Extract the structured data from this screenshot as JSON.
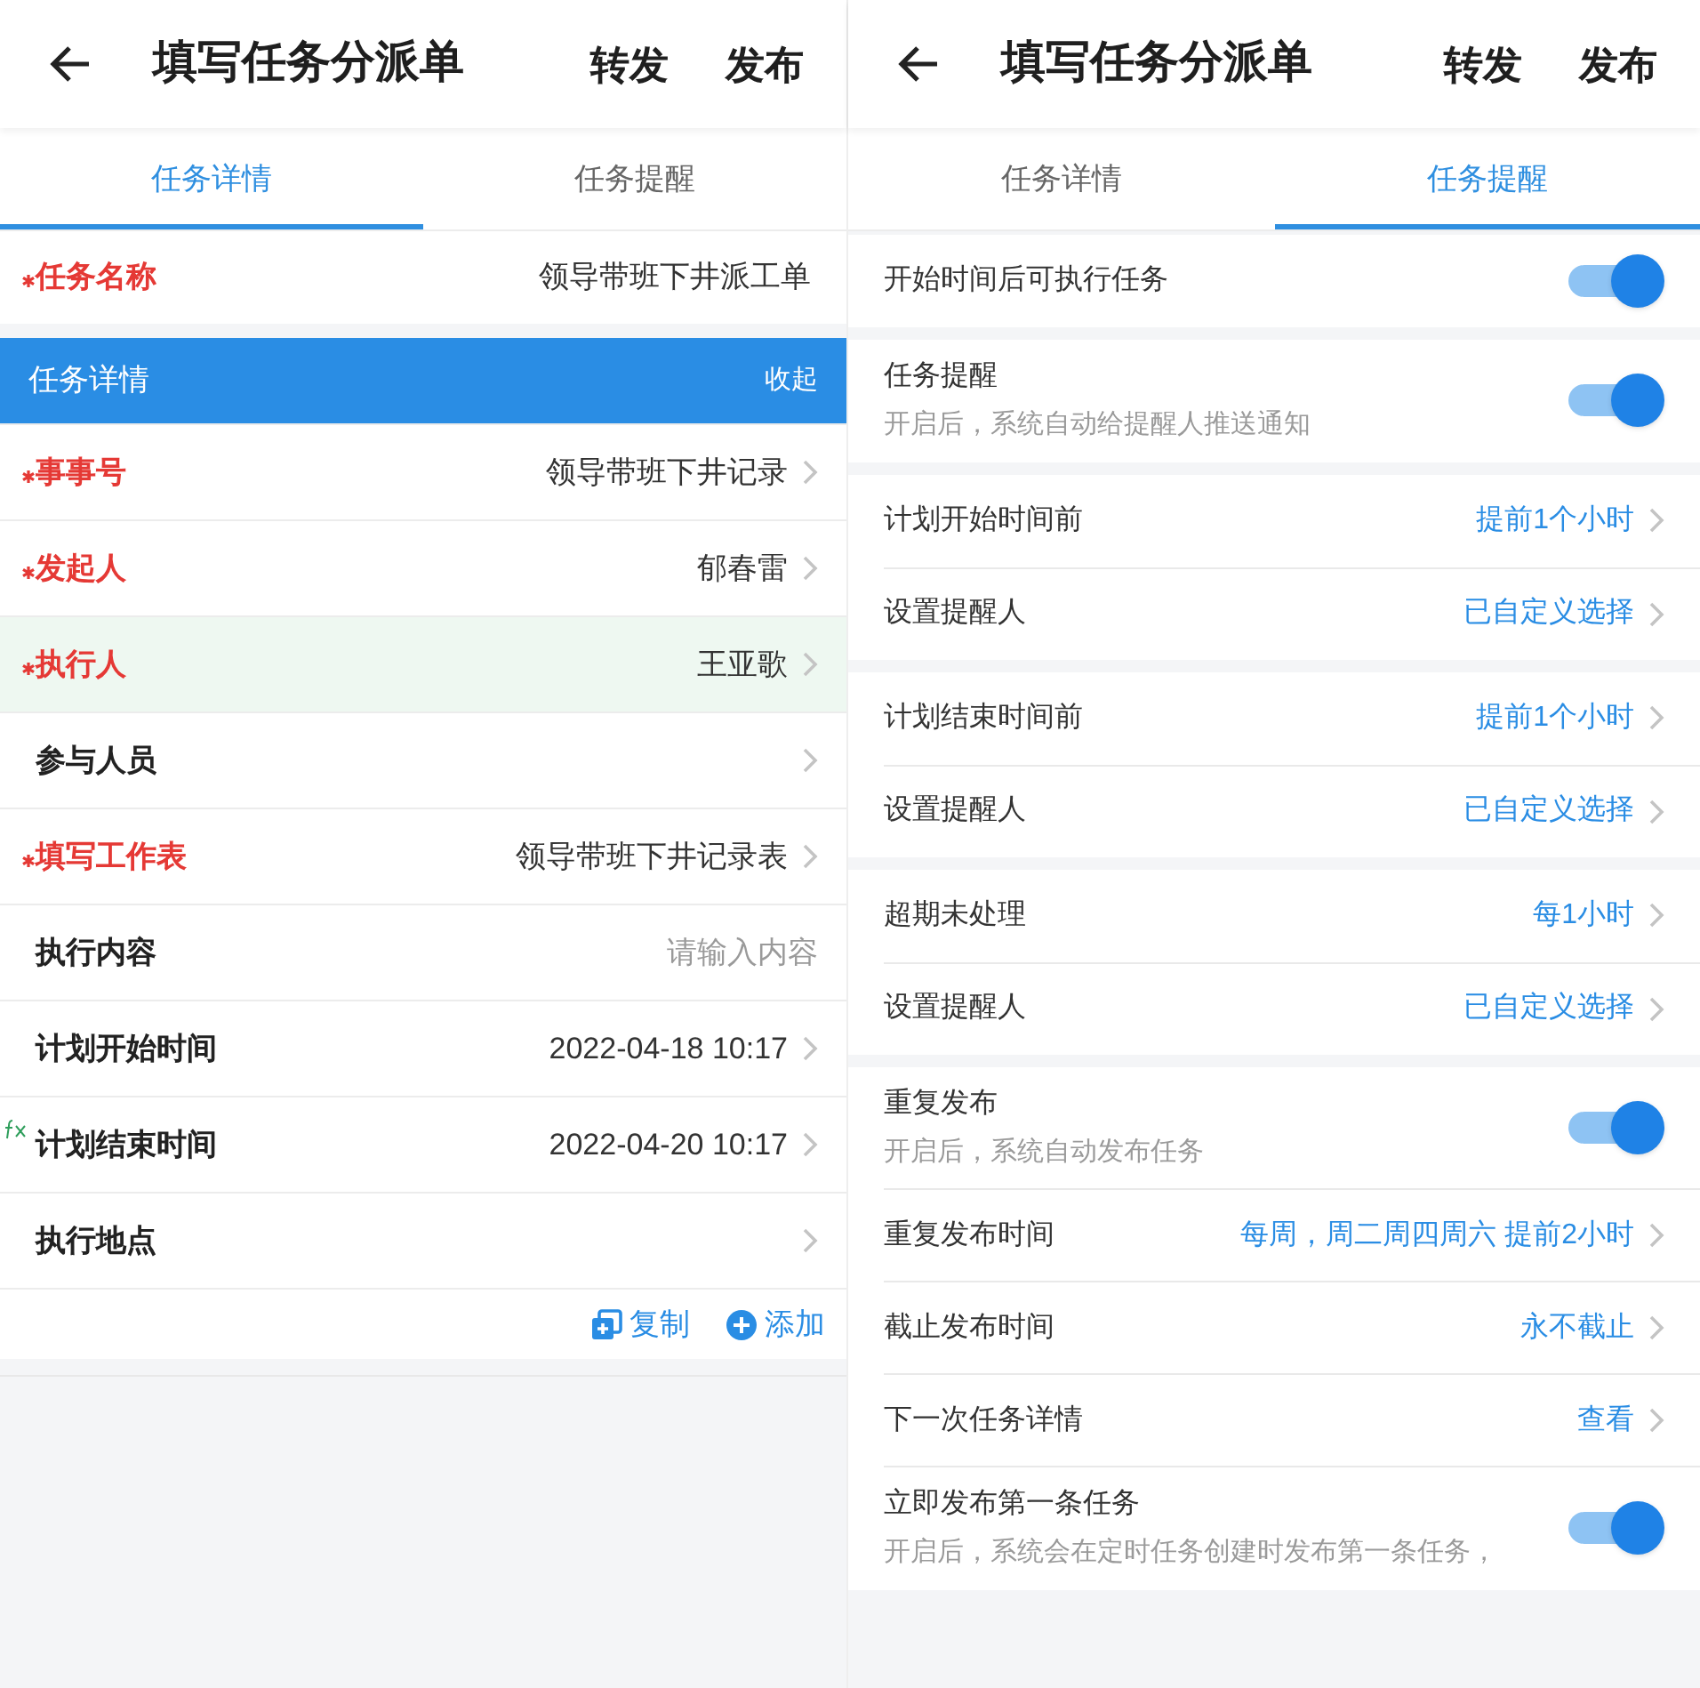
{
  "panels": [
    {
      "header": {
        "title": "填写任务分派单",
        "actions": [
          "转发",
          "发布"
        ]
      },
      "tabs": [
        {
          "label": "任务详情",
          "selected": true
        },
        {
          "label": "任务提醒",
          "selected": false
        }
      ],
      "name_row": {
        "label": "任务名称",
        "required": true,
        "value": "领导带班下井派工单"
      },
      "section": {
        "title": "任务详情",
        "action": "收起"
      },
      "rows": [
        {
          "label": "事事号",
          "required": true,
          "value": "领导带班下井记录",
          "highlighted": false,
          "formula": false
        },
        {
          "label": "发起人",
          "required": true,
          "value": "郁春雷",
          "highlighted": false,
          "formula": false
        },
        {
          "label": "执行人",
          "required": true,
          "value": "王亚歌",
          "highlighted": true,
          "formula": false
        },
        {
          "label": "参与人员",
          "required": false,
          "highlighted": false,
          "formula": false
        },
        {
          "label": "填写工作表",
          "required": true,
          "value": "领导带班下井记录表",
          "highlighted": false,
          "formula": false
        },
        {
          "label": "执行内容",
          "required": false,
          "placeholder": "请输入内容",
          "highlighted": false,
          "formula": false
        },
        {
          "label": "计划开始时间",
          "required": false,
          "value": "2022-04-18 10:17",
          "highlighted": false,
          "formula": false
        },
        {
          "label": "计划结束时间",
          "required": false,
          "value": "2022-04-20 10:17",
          "highlighted": false,
          "formula": true
        },
        {
          "label": "执行地点",
          "required": false,
          "highlighted": false,
          "formula": false
        }
      ],
      "row_actions": [
        {
          "kind": "copy",
          "label": "复制"
        },
        {
          "kind": "add",
          "label": "添加"
        }
      ]
    },
    {
      "header": {
        "title": "填写任务分派单",
        "actions": [
          "转发",
          "发布"
        ]
      },
      "tabs": [
        {
          "label": "任务详情",
          "selected": false
        },
        {
          "label": "任务提醒",
          "selected": true
        }
      ],
      "groups": [
        [
          {
            "kind": "toggle",
            "label": "开始时间后可执行任务",
            "on": true
          }
        ],
        [
          {
            "kind": "toggle",
            "label": "任务提醒",
            "hint": "开启后，系统自动给提醒人推送通知",
            "on": true
          }
        ],
        [
          {
            "kind": "link",
            "label": "计划开始时间前",
            "value": "提前1个小时"
          },
          {
            "kind": "link",
            "label": "设置提醒人",
            "value": "已自定义选择"
          }
        ],
        [
          {
            "kind": "link",
            "label": "计划结束时间前",
            "value": "提前1个小时"
          },
          {
            "kind": "link",
            "label": "设置提醒人",
            "value": "已自定义选择"
          }
        ],
        [
          {
            "kind": "link",
            "label": "超期未处理",
            "value": "每1小时"
          },
          {
            "kind": "link",
            "label": "设置提醒人",
            "value": "已自定义选择"
          }
        ],
        [
          {
            "kind": "toggle",
            "label": "重复发布",
            "hint": "开启后，系统自动发布任务",
            "on": true
          },
          {
            "kind": "link",
            "label": "重复发布时间",
            "value": "每周，周二周四周六 提前2小时"
          },
          {
            "kind": "link",
            "label": "截止发布时间",
            "value": "永不截止"
          },
          {
            "kind": "link",
            "label": "下一次任务详情",
            "value": "查看"
          },
          {
            "kind": "toggle",
            "label": "立即发布第一条任务",
            "hint": "开启后，系统会在定时任务创建时发布第一条任务，",
            "on": true
          }
        ]
      ]
    }
  ]
}
